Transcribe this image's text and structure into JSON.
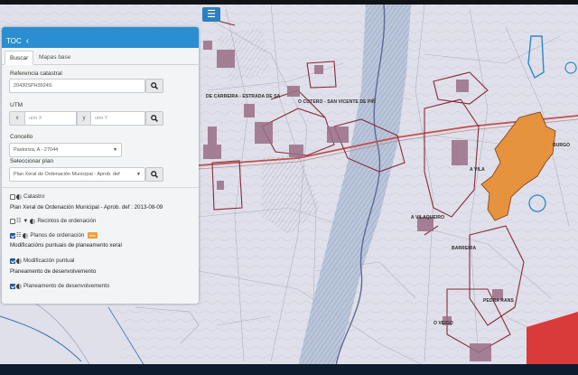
{
  "map": {
    "labels": [
      {
        "text": "DE CARREIRA - ESTRADA DE SA"
      },
      {
        "text": "O COTERO - SAN VICENTE DE PIÑ"
      },
      {
        "text": "A VILAQUEIRO"
      },
      {
        "text": "A VILA"
      },
      {
        "text": "BARREIRA"
      },
      {
        "text": "PEDRA RANS"
      },
      {
        "text": "O VEIGO"
      },
      {
        "text": "BURGO"
      }
    ],
    "colors": {
      "background": "#dfe0ea",
      "urban_fill": "#e8953f",
      "red_zone": "#d93a3a",
      "blue_band": "#b4c1d9",
      "plan_lines": "#8a2a3a",
      "road": "#c0504d",
      "blocks": "#9a6f86"
    }
  },
  "toc": {
    "title": "TOC",
    "tabs": [
      {
        "label": "Buscar",
        "active": true
      },
      {
        "label": "Mapas base",
        "active": false
      }
    ],
    "ref_catastral": {
      "label": "Referencia catastral",
      "value": "20430SPH3924S"
    },
    "utm": {
      "label": "UTM",
      "x_addon": "x",
      "x_placeholder": "utm X",
      "y_addon": "y",
      "y_placeholder": "utm Y"
    },
    "concello": {
      "label": "Concello",
      "selected": "Pastoriza, A - 27044"
    },
    "plan": {
      "label": "Seleccionar plan",
      "selected": "Plan Xeral de Ordenación Municipal - Aprob. def"
    },
    "layers": {
      "catastro": "Catastro",
      "plan_info": "Plan Xeral de Ordenación Municipal - Aprob. def : 2013-08-09",
      "recintos": "Recintos de ordenación",
      "planos": "Planos de ordenación",
      "planos_badge": "info",
      "modificacions_text": "Modificacións puntuais de planeamento xeral",
      "modificacion_puntual": "Modificación puntual",
      "planeamento_text": "Planeamento de desenvolvemento",
      "planeamento_desenv": "Planeamento de desenvolvemento"
    }
  }
}
